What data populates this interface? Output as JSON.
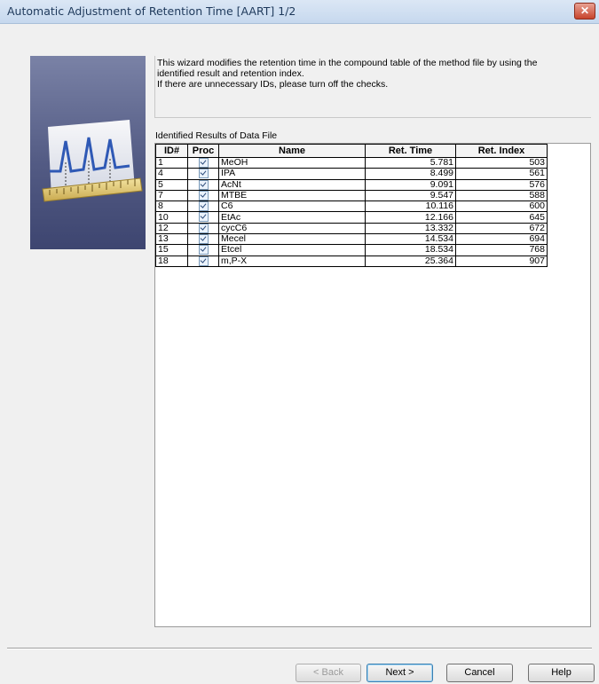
{
  "window": {
    "title": "Automatic Adjustment of Retention Time [AART] 1/2",
    "close_icon": "close-icon"
  },
  "description": {
    "line1": "This wizard modifies the retention time in the compound table of the method file by using the",
    "line2": "identified result and retention index.",
    "line3": "If there are unnecessary IDs, please turn off the checks."
  },
  "results": {
    "label": "Identified Results of Data File",
    "columns": [
      "ID#",
      "Proc",
      "Name",
      "Ret. Time",
      "Ret. Index"
    ],
    "rows": [
      {
        "id": "1",
        "proc": true,
        "name": "MeOH",
        "ret_time": "5.781",
        "ret_index": "503"
      },
      {
        "id": "4",
        "proc": true,
        "name": "IPA",
        "ret_time": "8.499",
        "ret_index": "561"
      },
      {
        "id": "5",
        "proc": true,
        "name": "AcNt",
        "ret_time": "9.091",
        "ret_index": "576"
      },
      {
        "id": "7",
        "proc": true,
        "name": "MTBE",
        "ret_time": "9.547",
        "ret_index": "588"
      },
      {
        "id": "8",
        "proc": true,
        "name": "C6",
        "ret_time": "10.116",
        "ret_index": "600"
      },
      {
        "id": "10",
        "proc": true,
        "name": "EtAc",
        "ret_time": "12.166",
        "ret_index": "645"
      },
      {
        "id": "12",
        "proc": true,
        "name": "cycC6",
        "ret_time": "13.332",
        "ret_index": "672"
      },
      {
        "id": "13",
        "proc": true,
        "name": "Mecel",
        "ret_time": "14.534",
        "ret_index": "694"
      },
      {
        "id": "15",
        "proc": true,
        "name": "Etcel",
        "ret_time": "18.534",
        "ret_index": "768"
      },
      {
        "id": "18",
        "proc": true,
        "name": "m,P-X",
        "ret_time": "25.364",
        "ret_index": "907"
      }
    ]
  },
  "buttons": {
    "back": "< Back",
    "next": "Next >",
    "cancel": "Cancel",
    "help": "Help"
  }
}
